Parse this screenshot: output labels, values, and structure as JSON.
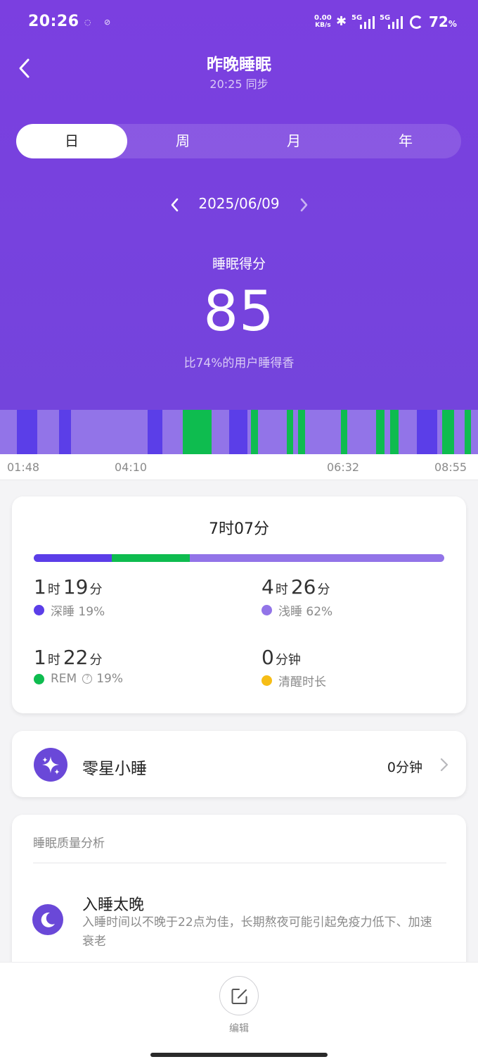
{
  "status_bar": {
    "time": "20:26",
    "net_speed_value": "0.00",
    "net_speed_unit": "KB/s",
    "sim1": "5G",
    "sim2": "5G",
    "battery": "72",
    "battery_unit": "%"
  },
  "header": {
    "title": "昨晚睡眠",
    "subtitle": "20:25 同步"
  },
  "tabs": [
    {
      "label": "日",
      "active": true
    },
    {
      "label": "周",
      "active": false
    },
    {
      "label": "月",
      "active": false
    },
    {
      "label": "年",
      "active": false
    }
  ],
  "date": "2025/06/09",
  "score": {
    "label": "睡眠得分",
    "value": "85",
    "compare": "比74%的用户睡得香"
  },
  "timeline": {
    "start": "01:48",
    "end": "08:55",
    "labels": [
      "01:48",
      "04:10",
      "06:32",
      "08:55"
    ],
    "stages": [
      {
        "stage": "light",
        "minutes": 10
      },
      {
        "stage": "deep",
        "minutes": 12
      },
      {
        "stage": "light",
        "minutes": 13
      },
      {
        "stage": "deep",
        "minutes": 7
      },
      {
        "stage": "light",
        "minutes": 45
      },
      {
        "stage": "deep",
        "minutes": 9
      },
      {
        "stage": "light",
        "minutes": 12
      },
      {
        "stage": "rem",
        "minutes": 17
      },
      {
        "stage": "light",
        "minutes": 10
      },
      {
        "stage": "deep",
        "minutes": 11
      },
      {
        "stage": "light",
        "minutes": 2
      },
      {
        "stage": "rem",
        "minutes": 4
      },
      {
        "stage": "light",
        "minutes": 17
      },
      {
        "stage": "rem",
        "minutes": 4
      },
      {
        "stage": "light",
        "minutes": 3
      },
      {
        "stage": "rem",
        "minutes": 4
      },
      {
        "stage": "light",
        "minutes": 21
      },
      {
        "stage": "rem",
        "minutes": 4
      },
      {
        "stage": "light",
        "minutes": 17
      },
      {
        "stage": "rem",
        "minutes": 5
      },
      {
        "stage": "light",
        "minutes": 3
      },
      {
        "stage": "rem",
        "minutes": 5
      },
      {
        "stage": "light",
        "minutes": 11
      },
      {
        "stage": "deep",
        "minutes": 12
      },
      {
        "stage": "light",
        "minutes": 3
      },
      {
        "stage": "rem",
        "minutes": 7
      },
      {
        "stage": "light",
        "minutes": 6
      },
      {
        "stage": "rem",
        "minutes": 4
      },
      {
        "stage": "light",
        "minutes": 4
      }
    ]
  },
  "summary": {
    "total": "7时07分",
    "distribution_percent": {
      "deep": 19,
      "rem": 19,
      "light": 62
    },
    "deep": {
      "hours": "1",
      "hour_unit": "时",
      "minutes": "19",
      "minute_unit": "分",
      "label": "深睡 19%"
    },
    "light": {
      "hours": "4",
      "hour_unit": "时",
      "minutes": "26",
      "minute_unit": "分",
      "label": "浅睡 62%"
    },
    "rem": {
      "hours": "1",
      "hour_unit": "时",
      "minutes": "22",
      "minute_unit": "分",
      "label_name": "REM",
      "label_pct": "19%"
    },
    "awake": {
      "value": "0",
      "unit": "分钟",
      "label": "清醒时长"
    }
  },
  "nap": {
    "label": "零星小睡",
    "value": "0分钟"
  },
  "quality": {
    "title": "睡眠质量分析",
    "items": [
      {
        "heading": "入睡太晚",
        "description": "入睡时间以不晚于22点为佳，长期熬夜可能引起免疫力低下、加速衰老"
      }
    ]
  },
  "bottom": {
    "edit_label": "编辑"
  },
  "colors": {
    "primary": "#7b3fe0",
    "deep": "#5b3ee8",
    "light": "#9274e8",
    "rem": "#0ebc4f",
    "awake": "#f6bd16",
    "icon_bg": "#6a48d8"
  }
}
